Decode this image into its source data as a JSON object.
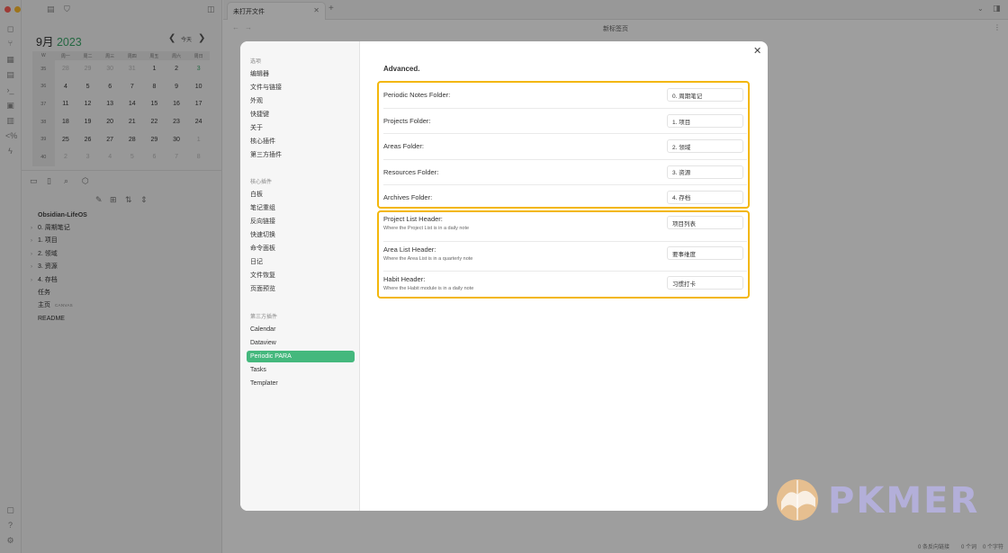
{
  "tab": {
    "title": "未打开文件"
  },
  "page": {
    "title": "新标签页"
  },
  "calendar": {
    "month": "9月",
    "year": "2023",
    "today_label": "今天",
    "weekday_headers": [
      "W",
      "周一",
      "周二",
      "周三",
      "周四",
      "周五",
      "周六",
      "周日"
    ],
    "weeks": [
      [
        "35",
        "28",
        "29",
        "30",
        "31",
        "1",
        "2",
        "3"
      ],
      [
        "36",
        "4",
        "5",
        "6",
        "7",
        "8",
        "9",
        "10"
      ],
      [
        "37",
        "11",
        "12",
        "13",
        "14",
        "15",
        "16",
        "17"
      ],
      [
        "38",
        "18",
        "19",
        "20",
        "21",
        "22",
        "23",
        "24"
      ],
      [
        "39",
        "25",
        "26",
        "27",
        "28",
        "29",
        "30",
        "1"
      ],
      [
        "40",
        "2",
        "3",
        "4",
        "5",
        "6",
        "7",
        "8"
      ]
    ]
  },
  "file_tree": {
    "vault": "Obsidian-LifeOS",
    "items": [
      {
        "label": "0. 周期笔记",
        "folder": true
      },
      {
        "label": "1. 项目",
        "folder": true
      },
      {
        "label": "2. 领域",
        "folder": true
      },
      {
        "label": "3. 资源",
        "folder": true
      },
      {
        "label": "4. 存档",
        "folder": true
      },
      {
        "label": "任务",
        "folder": false
      },
      {
        "label": "主页",
        "folder": false,
        "tag": "CANVAS"
      },
      {
        "label": "README",
        "folder": false
      }
    ]
  },
  "settings_nav": {
    "options_header": "选项",
    "options": [
      "编辑器",
      "文件与链接",
      "外观",
      "快捷键",
      "关于",
      "核心插件",
      "第三方插件"
    ],
    "core_header": "核心插件",
    "core": [
      "白板",
      "笔记重组",
      "反向链接",
      "快速切换",
      "命令面板",
      "日记",
      "文件恢复",
      "页面预览"
    ],
    "community_header": "第三方插件",
    "community": [
      "Calendar",
      "Dataview",
      "Periodic PARA",
      "Tasks",
      "Templater"
    ],
    "active": "Periodic PARA"
  },
  "settings_content": {
    "section_title": "Advanced.",
    "folders": [
      {
        "name": "Periodic Notes Folder:",
        "value": "0. 周期笔记"
      },
      {
        "name": "Projects Folder:",
        "value": "1. 项目"
      },
      {
        "name": "Areas Folder:",
        "value": "2. 领域"
      },
      {
        "name": "Resources Folder:",
        "value": "3. 资源"
      },
      {
        "name": "Archives Folder:",
        "value": "4. 存档"
      }
    ],
    "headers": [
      {
        "name": "Project List Header:",
        "desc": "Where the Project List is in a daily note",
        "value": "项目列表"
      },
      {
        "name": "Area List Header:",
        "desc": "Where the Area List is in a quarterly note",
        "value": "要事维度"
      },
      {
        "name": "Habit Header:",
        "desc": "Where the Habit module is in a daily note",
        "value": "习惯打卡"
      }
    ]
  },
  "status_bar": {
    "backlinks": "0 条反向链接",
    "words": "0 个词",
    "chars": "0 个字符"
  },
  "watermark": {
    "text": "PKMER"
  },
  "colors": {
    "accent": "#44b87d",
    "highlight": "#f3b70b",
    "calendar_year": "#3ca86b"
  }
}
